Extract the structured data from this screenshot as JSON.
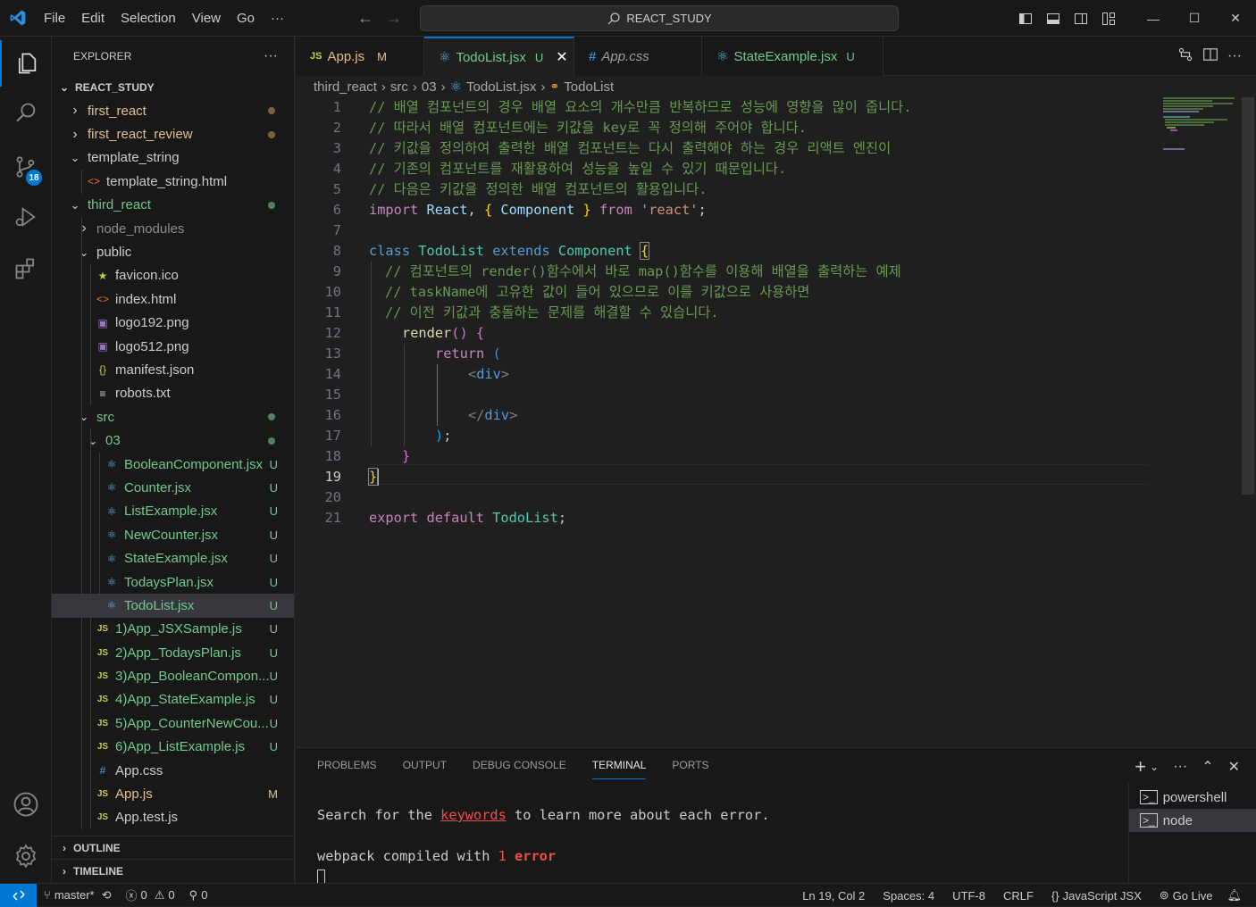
{
  "titlebar": {
    "menu": [
      "File",
      "Edit",
      "Selection",
      "View",
      "Go"
    ],
    "more": "···",
    "search_text": "REACT_STUDY",
    "minimize": "—",
    "maximize": "☐",
    "close": "✕"
  },
  "activity": {
    "source_control_badge": "18"
  },
  "explorer": {
    "title": "EXPLORER",
    "more": "···",
    "root": "REACT_STUDY",
    "outline": "OUTLINE",
    "timeline": "TIMELINE"
  },
  "tree": [
    {
      "label": "first_react",
      "status": "",
      "dot": "brown",
      "color": "#e2c08d"
    },
    {
      "label": "first_react_review",
      "status": "",
      "dot": "brown",
      "color": "#e2c08d"
    },
    {
      "label": "template_string",
      "status": "",
      "dot": "",
      "color": "#cccccc"
    },
    {
      "label": "template_string.html",
      "status": "",
      "dot": "",
      "color": "#cccccc"
    },
    {
      "label": "third_react",
      "status": "",
      "dot": "green",
      "color": "#73c991"
    },
    {
      "label": "node_modules",
      "status": "",
      "dot": "",
      "color": "#8c8c8c"
    },
    {
      "label": "public",
      "status": "",
      "dot": "",
      "color": "#cccccc"
    },
    {
      "label": "favicon.ico",
      "status": "",
      "dot": "",
      "color": "#cccccc"
    },
    {
      "label": "index.html",
      "status": "",
      "dot": "",
      "color": "#cccccc"
    },
    {
      "label": "logo192.png",
      "status": "",
      "dot": "",
      "color": "#cccccc"
    },
    {
      "label": "logo512.png",
      "status": "",
      "dot": "",
      "color": "#cccccc"
    },
    {
      "label": "manifest.json",
      "status": "",
      "dot": "",
      "color": "#cccccc"
    },
    {
      "label": "robots.txt",
      "status": "",
      "dot": "",
      "color": "#cccccc"
    },
    {
      "label": "src",
      "status": "",
      "dot": "green",
      "color": "#73c991"
    },
    {
      "label": "03",
      "status": "",
      "dot": "green",
      "color": "#73c991"
    },
    {
      "label": "BooleanComponent.jsx",
      "status": "U",
      "dot": "",
      "color": "#73c991"
    },
    {
      "label": "Counter.jsx",
      "status": "U",
      "dot": "",
      "color": "#73c991"
    },
    {
      "label": "ListExample.jsx",
      "status": "U",
      "dot": "",
      "color": "#73c991"
    },
    {
      "label": "NewCounter.jsx",
      "status": "U",
      "dot": "",
      "color": "#73c991"
    },
    {
      "label": "StateExample.jsx",
      "status": "U",
      "dot": "",
      "color": "#73c991"
    },
    {
      "label": "TodaysPlan.jsx",
      "status": "U",
      "dot": "",
      "color": "#73c991"
    },
    {
      "label": "TodoList.jsx",
      "status": "U",
      "dot": "",
      "color": "#73c991"
    },
    {
      "label": "1)App_JSXSample.js",
      "status": "U",
      "dot": "",
      "color": "#73c991"
    },
    {
      "label": "2)App_TodaysPlan.js",
      "status": "U",
      "dot": "",
      "color": "#73c991"
    },
    {
      "label": "3)App_BooleanCompon...",
      "status": "U",
      "dot": "",
      "color": "#73c991"
    },
    {
      "label": "4)App_StateExample.js",
      "status": "U",
      "dot": "",
      "color": "#73c991"
    },
    {
      "label": "5)App_CounterNewCou...",
      "status": "U",
      "dot": "",
      "color": "#73c991"
    },
    {
      "label": "6)App_ListExample.js",
      "status": "U",
      "dot": "",
      "color": "#73c991"
    },
    {
      "label": "App.css",
      "status": "",
      "dot": "",
      "color": "#cccccc"
    },
    {
      "label": "App.js",
      "status": "M",
      "dot": "",
      "color": "#e2c08d"
    },
    {
      "label": "App.test.js",
      "status": "",
      "dot": "",
      "color": "#cccccc"
    }
  ],
  "tabs": [
    {
      "label": "App.js",
      "mark": "M"
    },
    {
      "label": "TodoList.jsx",
      "mark": "U"
    },
    {
      "label": "App.css",
      "mark": ""
    },
    {
      "label": "StateExample.jsx",
      "mark": "U"
    }
  ],
  "breadcrumb": {
    "p1": "third_react",
    "p2": "src",
    "p3": "03",
    "p4": "TodoList.jsx",
    "p5": "TodoList"
  },
  "code": {
    "l1": "// 배열 컴포넌트의 경우 배열 요소의 개수만큼 반복하므로 성능에 영향을 많이 줍니다.",
    "l2": "// 따라서 배열 컴포넌트에는 키값을 key로 꼭 정의해 주어야 합니다.",
    "l3": "// 키값을 정의하여 출력한 배열 컴포넌트는 다시 출력해야 하는 경우 리액트 엔진이",
    "l4": "// 기존의 컴포넌트를 재활용하여 성능을 높일 수 있기 때문입니다.",
    "l5": "// 다음은 키값을 정의한 배열 컴포넌트의 활용입니다.",
    "l9": "// 컴포넌트의 render()함수에서 바로 map()함수를 이용해 배열을 출력하는 예제",
    "l10": "// taskName에 고유한 값이 들어 있으므로 이를 키값으로 사용하면",
    "l11": "// 이전 키값과 충돌하는 문제를 해결할 수 있습니다.",
    "import": "import",
    "react_id": "React",
    "component_id": "Component",
    "from": "from",
    "react_str": "'react'",
    "class": "class",
    "todolist": "TodoList",
    "extends": "extends",
    "render": "render",
    "return": "return",
    "div_open": "div",
    "div_close": "div",
    "export": "export",
    "default": "default"
  },
  "panel": {
    "tabs": [
      "PROBLEMS",
      "OUTPUT",
      "DEBUG CONSOLE",
      "TERMINAL",
      "PORTS"
    ],
    "term_line1_a": "Search for the ",
    "term_line1_link": "keywords",
    "term_line1_b": " to learn more about each error.",
    "term_line2_a": "webpack compiled with ",
    "term_line2_num": "1",
    "term_line2_err": "error",
    "terminals": [
      "powershell",
      "node"
    ]
  },
  "status": {
    "branch": "master*",
    "errors": "0",
    "warnings": "0",
    "ports": "0",
    "position": "Ln 19, Col 2",
    "spaces": "Spaces: 4",
    "encoding": "UTF-8",
    "eol": "CRLF",
    "language": "JavaScript JSX",
    "golive": "Go Live"
  },
  "colors": {
    "accent": "#0078d4",
    "untracked": "#73c991",
    "modified": "#e2c08d"
  }
}
